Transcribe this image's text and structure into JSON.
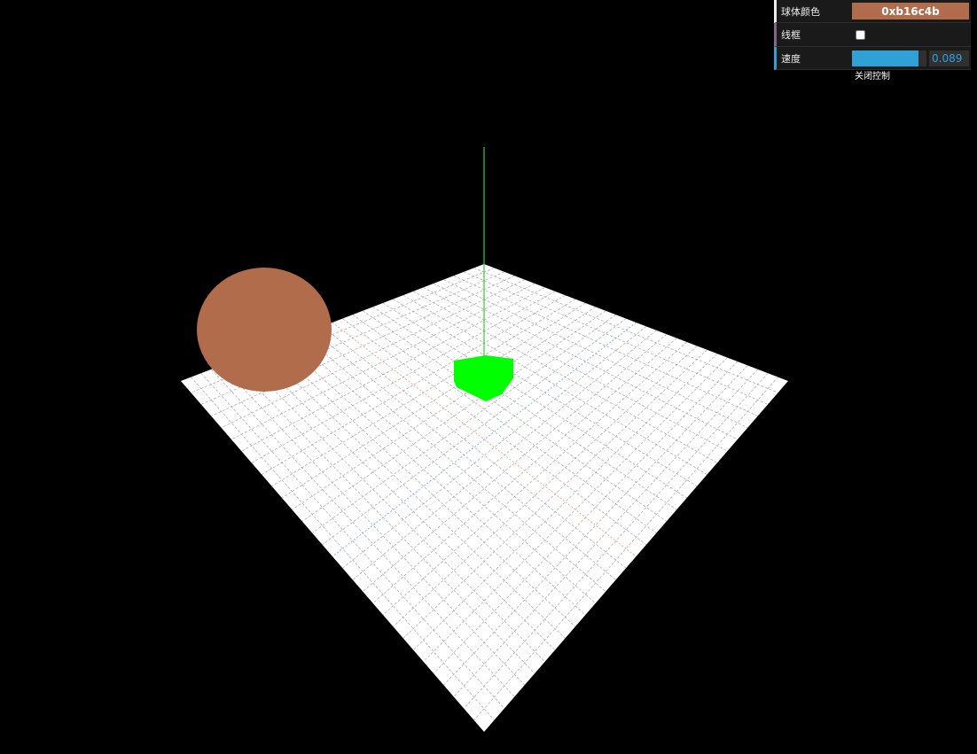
{
  "scene": {
    "background_color": "#000000",
    "sphere_color": "#b16c4b",
    "cube_color": "#00ff00",
    "plane_color": "#ffffff",
    "y_axis_color": "#33cc33",
    "x_axis_color": "#ff7040",
    "z_axis_color": "#4080ff"
  },
  "controls": {
    "sphere_color_label": "球体颜色",
    "sphere_color_value": "0xb16c4b",
    "wireframe_label": "线框",
    "wireframe_checked": false,
    "speed_label": "速度",
    "speed_value": "0.089",
    "speed_fraction": 0.89,
    "close_label": "关闭控制"
  }
}
